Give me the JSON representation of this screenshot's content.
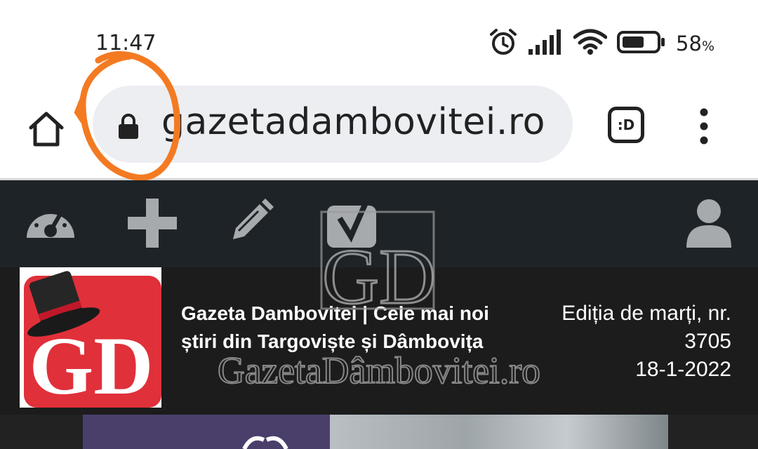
{
  "status_bar": {
    "time": "11:47",
    "battery_percent": "58",
    "battery_suffix": "%",
    "icons": [
      "alarm-icon",
      "signal-icon",
      "wifi-icon",
      "battery-icon"
    ]
  },
  "browser": {
    "url": "gazetadambovitei.ro",
    "tab_label": ":D",
    "icons": [
      "home-icon",
      "lock-icon",
      "tab-switcher-icon",
      "overflow-menu-icon"
    ]
  },
  "admin_bar": {
    "icons": [
      "dashboard-icon",
      "plus-icon",
      "pencil-icon",
      "yoast-icon",
      "user-icon"
    ]
  },
  "site_header": {
    "logo_text": "GD",
    "title": "Gazeta Dambovitei | Cele mai noi știri din Targoviște și Dâmbovița",
    "edition_line": "Ediția de marți, nr.",
    "edition_number": "3705",
    "date": "18-1-2022"
  },
  "watermark": {
    "monogram": "GD",
    "text": "GazetaDâmbovitei.ro"
  },
  "colors": {
    "annotation": "#f47a22",
    "admin_bar": "#1e2327",
    "logo_red": "#e0303a",
    "header_bg": "#1c1c1c"
  }
}
